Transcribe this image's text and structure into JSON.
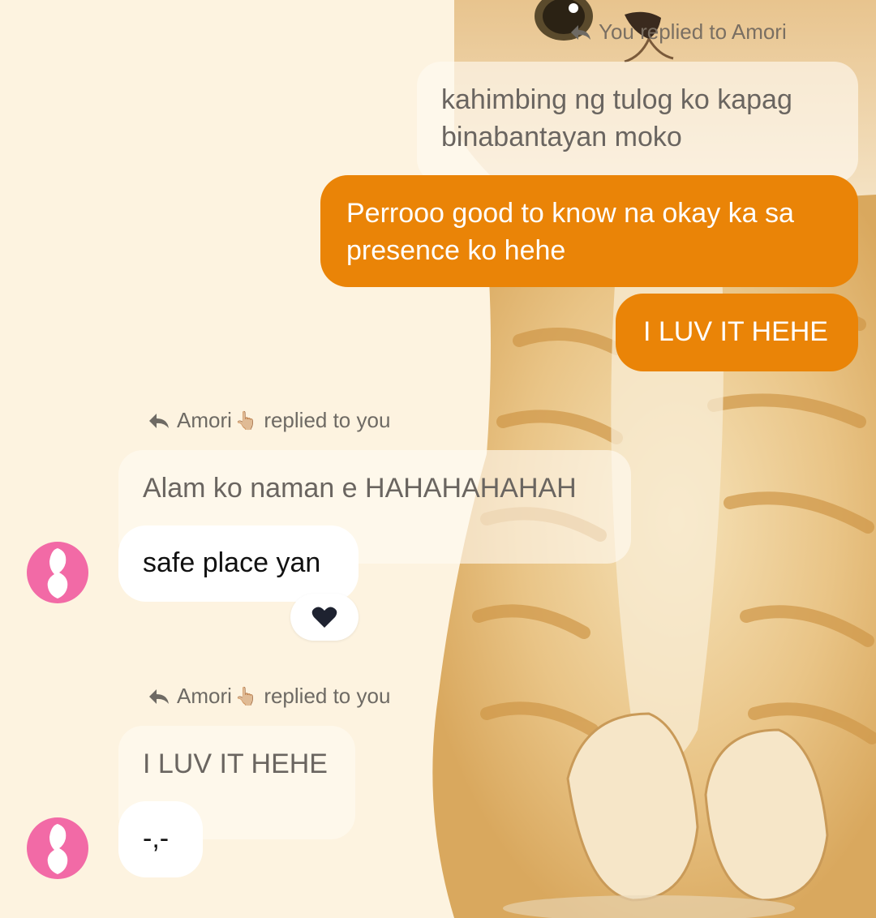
{
  "thread": {
    "reply_1": {
      "meta_text": "You replied to Amori",
      "quoted_text": "kahimbing ng tulog ko kapag binabantayan moko",
      "quoted_line_1": "kahimbing ng tulog ko kapag",
      "quoted_line_2": "binabantayan moko",
      "message_line_1": "Perrooo good to know na okay ka sa",
      "message_line_2": "presence ko hehe"
    },
    "message_2": "I LUV IT HEHE",
    "reply_2": {
      "sender": "Amori",
      "sender_emoji": "👆🏼",
      "meta_suffix": "replied to you",
      "quoted_text": "Alam ko naman e HAHAHAHAHAH",
      "message": "safe place yan",
      "reaction": "🖤"
    },
    "reply_3": {
      "sender": "Amori",
      "sender_emoji": "👆🏼",
      "meta_suffix": "replied to you",
      "quoted_text": "I LUV IT HEHE",
      "message": "-,-"
    }
  },
  "colors": {
    "outgoing_bubble": "#ea8407",
    "incoming_bubble": "#ffffff",
    "avatar": "#f26aa6",
    "background": "#fdf3e0"
  },
  "icons": {
    "reply": "reply-arrow-icon",
    "reaction": "black-heart-icon"
  }
}
